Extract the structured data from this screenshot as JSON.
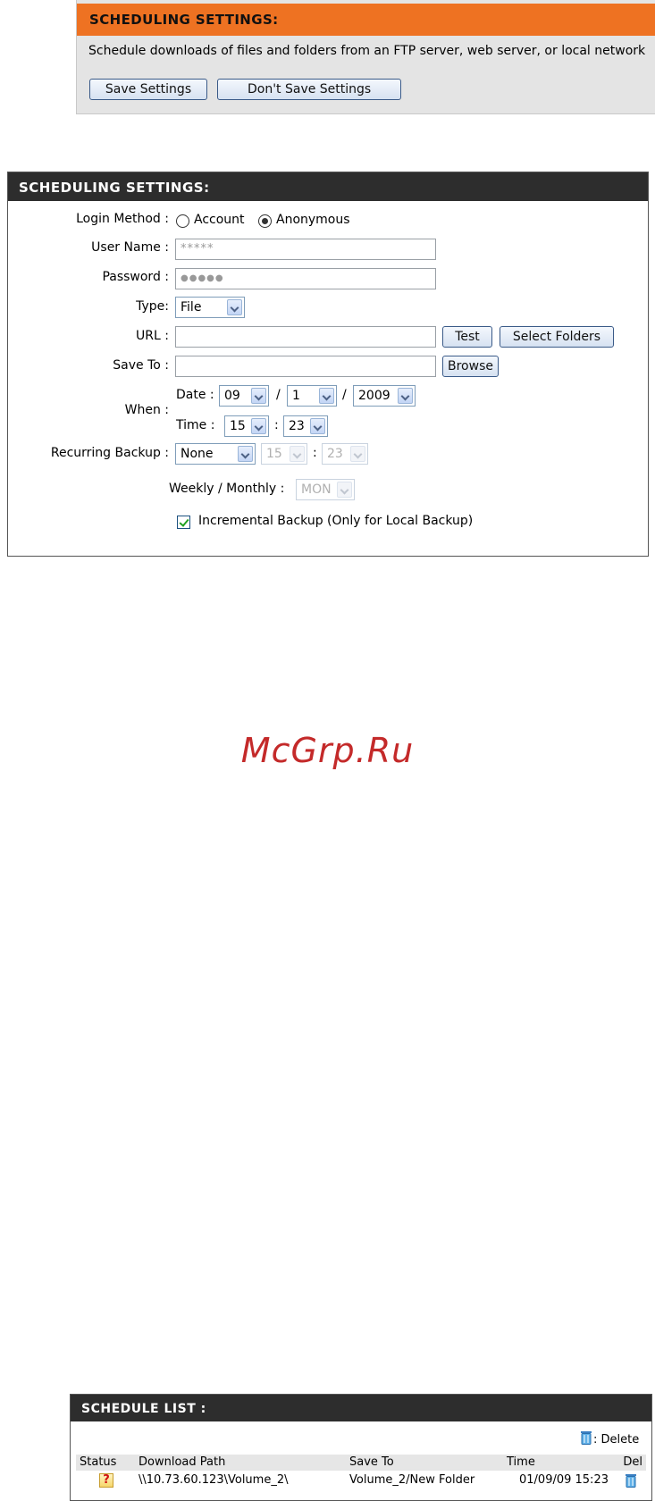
{
  "top_panel": {
    "title": "SCHEDULING SETTINGS:",
    "description": "Schedule downloads of files and folders from an FTP server, web server, or local network",
    "save_label": "Save Settings",
    "dont_save_label": "Don't Save Settings"
  },
  "settings": {
    "title": "SCHEDULING SETTINGS:",
    "login_method_label": "Login Method :",
    "login_options": [
      "Account",
      "Anonymous"
    ],
    "login_selected": "Anonymous",
    "user_name_label": "User Name :",
    "user_name_value": "*****",
    "password_label": "Password :",
    "password_value": "●●●●●",
    "type_label": "Type:",
    "type_value": "File",
    "url_label": "URL :",
    "url_value": "",
    "test_label": "Test",
    "select_folders_label": "Select Folders",
    "save_to_label": "Save To :",
    "save_to_value": "",
    "browse_label": "Browse",
    "when_label": "When :",
    "date_label": "Date :",
    "date_month": "09",
    "date_day": "1",
    "date_year": "2009",
    "slash": "/",
    "time_label": "Time :",
    "time_hour": "15",
    "time_minute": "23",
    "colon": ":",
    "recurring_label": "Recurring Backup :",
    "recurring_value": "None",
    "recurring_hour": "15",
    "recurring_minute": "23",
    "weekly_monthly_label": "Weekly / Monthly :",
    "weekly_monthly_value": "MON",
    "incremental_label": "Incremental Backup (Only for Local Backup)",
    "incremental_checked": true
  },
  "watermark": "McGrp.Ru",
  "schedule_list": {
    "title": "SCHEDULE LIST :",
    "delete_legend": ": Delete",
    "columns": [
      "Status",
      "Download Path",
      "Save To",
      "Time",
      "Del"
    ],
    "rows": [
      {
        "status": "?",
        "download_path": "\\\\10.73.60.123\\Volume_2\\",
        "save_to": "Volume_2/New Folder",
        "time": "01/09/09 15:23"
      }
    ]
  },
  "colors": {
    "orange_header": "#ee7222",
    "dark_header": "#2d2d2d",
    "watermark": "#c42a2a"
  }
}
